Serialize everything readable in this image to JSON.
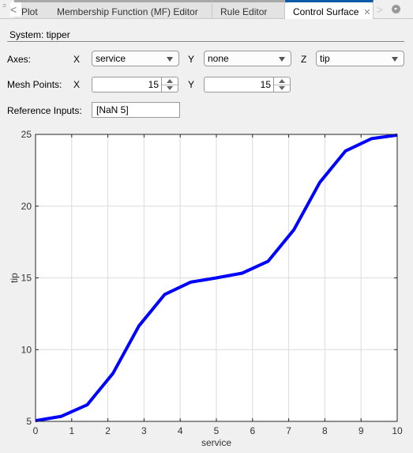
{
  "tabs": [
    {
      "label": "Plot",
      "active": false
    },
    {
      "label": "Membership Function (MF) Editor",
      "active": false
    },
    {
      "label": "Rule Editor",
      "active": false
    },
    {
      "label": "Control Surface",
      "active": true,
      "closable": true
    }
  ],
  "system": {
    "label": "System: tipper"
  },
  "axes": {
    "label": "Axes:",
    "x_label": "X",
    "x_value": "service",
    "y_label": "Y",
    "y_value": "none",
    "z_label": "Z",
    "z_value": "tip"
  },
  "mesh": {
    "label": "Mesh Points:",
    "x_label": "X",
    "x_value": "15",
    "y_label": "Y",
    "y_value": "15"
  },
  "reference": {
    "label": "Reference Inputs:",
    "value": "[NaN 5]"
  },
  "colors": {
    "line": "#0000ff",
    "active_tab": "#0a5aa8"
  },
  "chart_data": {
    "type": "line",
    "title": "",
    "xlabel": "service",
    "ylabel": "tip",
    "xlim": [
      0,
      10
    ],
    "ylim": [
      5,
      25
    ],
    "xticks": [
      0,
      1,
      2,
      3,
      4,
      5,
      6,
      7,
      8,
      9,
      10
    ],
    "yticks": [
      5,
      10,
      15,
      20,
      25
    ],
    "grid": true,
    "series": [
      {
        "name": "tip",
        "x": [
          0,
          0.714,
          1.429,
          2.143,
          2.857,
          3.571,
          4.286,
          5.0,
          5.714,
          6.429,
          7.143,
          7.857,
          8.571,
          9.286,
          10.0
        ],
        "y": [
          5.05,
          5.35,
          6.15,
          8.35,
          11.65,
          13.85,
          14.7,
          15.0,
          15.33,
          16.15,
          18.35,
          21.65,
          23.85,
          24.7,
          24.95
        ]
      }
    ]
  }
}
